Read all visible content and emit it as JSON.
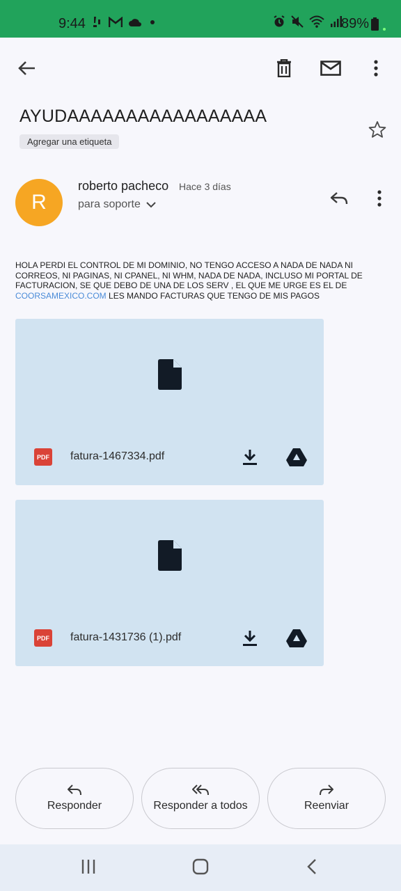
{
  "status_bar": {
    "time": "9:44",
    "battery": "89%",
    "left_icons": [
      "steps-icon",
      "gmail-icon",
      "cloud-icon",
      "dot-icon"
    ],
    "right_icons": [
      "alarm-icon",
      "mute-icon",
      "wifi-icon",
      "signal-icon",
      "battery-icon"
    ]
  },
  "toolbar": {
    "back": "back-arrow-icon",
    "delete": "trash-icon",
    "mark_unread": "envelope-icon",
    "more": "more-vert-icon"
  },
  "email": {
    "subject": "AYUDAAAAAAAAAAAAAAAAA",
    "label_chip": "Agregar una etiqueta",
    "sender_initial": "R",
    "sender_name": "roberto pacheco",
    "time_ago": "Hace 3 días",
    "recipient": "para soporte",
    "body_part1": "HOLA PERDI EL CONTROL DE MI DOMINIO, NO TENGO ACCESO A NADA DE NADA NI CORREOS, NI PAGINAS, NI CPANEL, NI WHM, NADA DE NADA, INCLUSO MI PORTAL DE FACTURACION, SE QUE DEBO DE UNA DE LOS SERV , EL QUE ME URGE ES EL DE ",
    "body_link": "COORSAMEXICO.COM",
    "body_part2": " LES MANDO FACTURAS QUE TENGO DE MIS PAGOS"
  },
  "attachments": [
    {
      "filename": "fatura-1467334.pdf",
      "type_badge": "PDF"
    },
    {
      "filename": "fatura-1431736 (1).pdf",
      "type_badge": "PDF"
    }
  ],
  "actions": {
    "reply": "Responder",
    "reply_all": "Responder a todos",
    "forward": "Reenviar"
  },
  "colors": {
    "status_bar": "#21a35b",
    "avatar": "#f6a623",
    "attachment_bg": "#d1e3f1",
    "pdf_badge": "#da4337",
    "link": "#4a8bd8"
  }
}
